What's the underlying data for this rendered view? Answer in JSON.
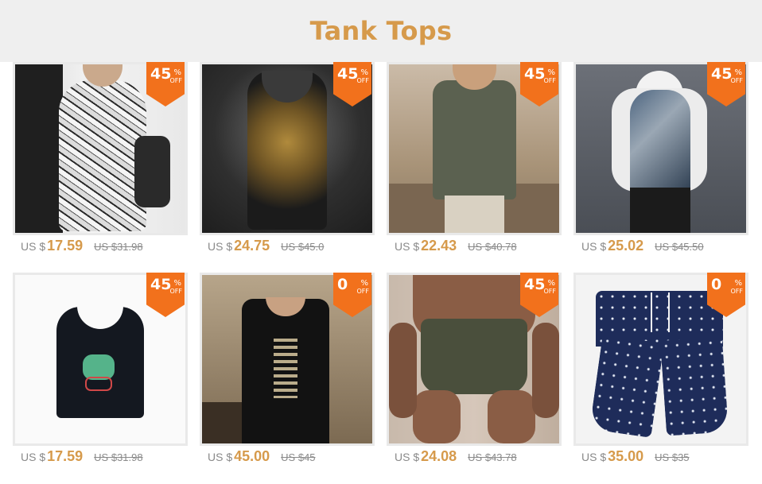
{
  "header": {
    "title": "Tank Tops"
  },
  "colors": {
    "accent": "#d69a4b",
    "badge": "#f2711c",
    "muted": "#8a8a8a",
    "header_bg": "#efefef"
  },
  "products": [
    {
      "discount": "45",
      "pct": "%",
      "off": "OFF",
      "currency": "US $",
      "price": "17.59",
      "old_price": "US $31.98",
      "image": "newspaper-print-tank-top-photo"
    },
    {
      "discount": "45",
      "pct": "%",
      "off": "OFF",
      "currency": "US $",
      "price": "24.75",
      "old_price": "US $45.0",
      "image": "gold-dragon-tank-top-photo"
    },
    {
      "discount": "45",
      "pct": "%",
      "off": "OFF",
      "currency": "US $",
      "price": "22.43",
      "old_price": "US $40.78",
      "image": "green-linen-vest-photo"
    },
    {
      "discount": "45",
      "pct": "%",
      "off": "OFF",
      "currency": "US $",
      "price": "25.02",
      "old_price": "US $45.50",
      "image": "denim-print-tank-top-photo"
    },
    {
      "discount": "45",
      "pct": "%",
      "off": "OFF",
      "currency": "US $",
      "price": "17.59",
      "old_price": "US $31.98",
      "image": "dinosaur-bicycle-tank-top-photo"
    },
    {
      "discount": "0",
      "pct": "%",
      "off": "OFF",
      "currency": "US $",
      "price": "45.00",
      "old_price": "US $45",
      "image": "black-calligraphy-tank-top-photo"
    },
    {
      "discount": "45",
      "pct": "%",
      "off": "OFF",
      "currency": "US $",
      "price": "24.08",
      "old_price": "US $43.78",
      "image": "olive-shorts-photo"
    },
    {
      "discount": "0",
      "pct": "%",
      "off": "OFF",
      "currency": "US $",
      "price": "35.00",
      "old_price": "US $35",
      "image": "navy-print-shorts-photo"
    }
  ]
}
